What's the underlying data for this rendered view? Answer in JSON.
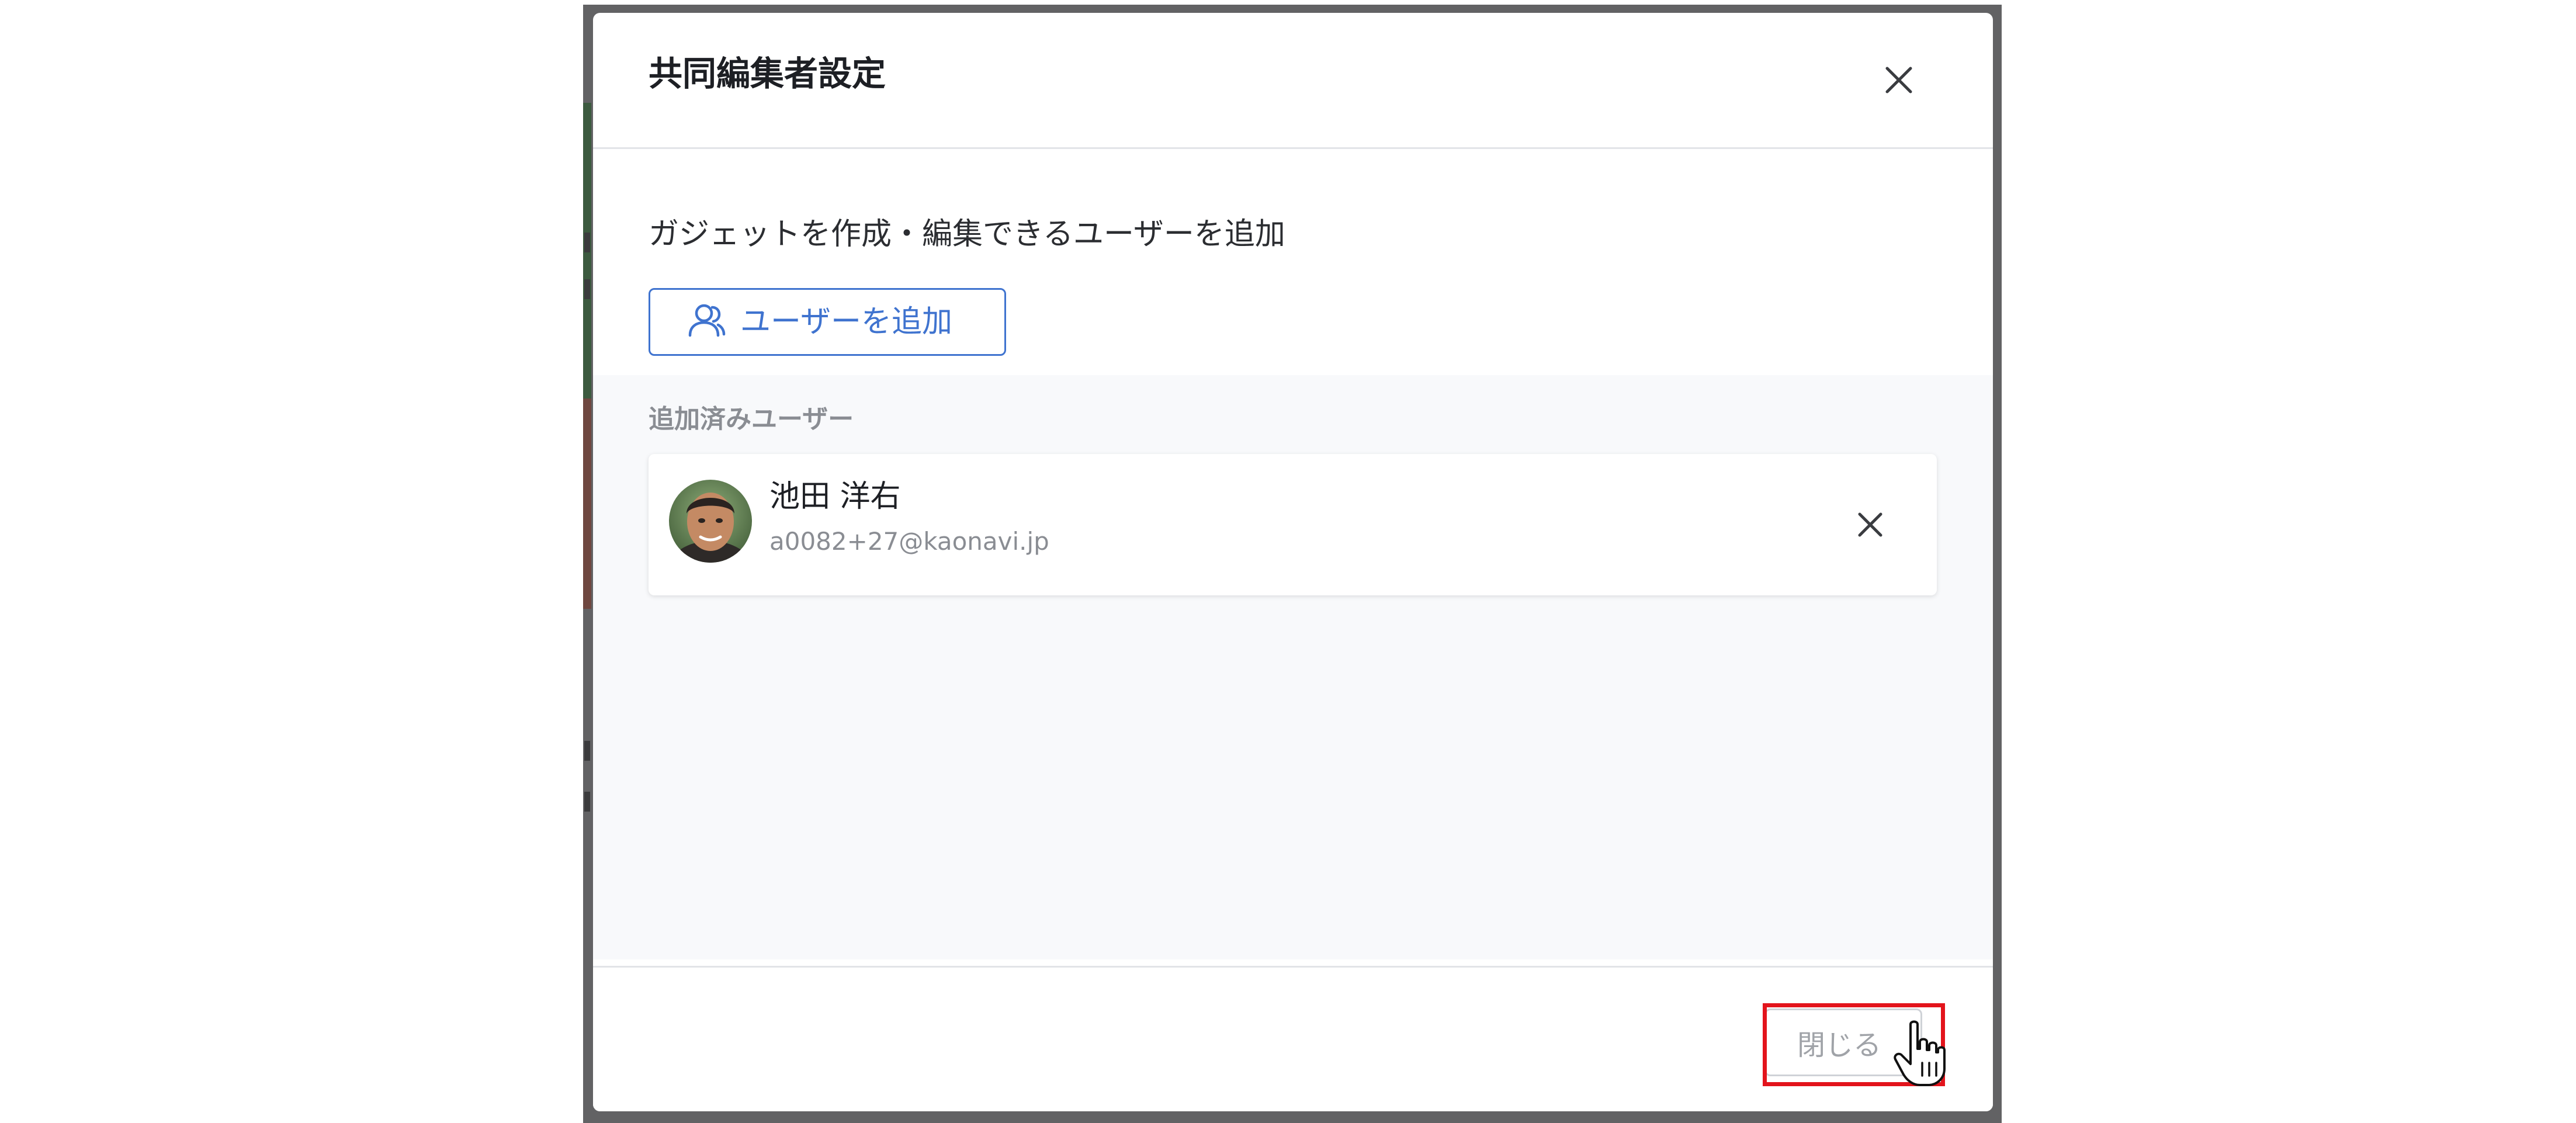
{
  "modal": {
    "title": "共同編集者設定",
    "description": "ガジェットを作成・編集できるユーザーを追加",
    "add_user_label": "ユーザーを追加",
    "added_users_label": "追加済みユーザー",
    "users": [
      {
        "name": "池田 洋右",
        "email": "a0082+27@kaonavi.jp"
      }
    ],
    "close_label": "閉じる"
  },
  "colors": {
    "accent": "#3f73cf",
    "highlight": "#e3141c",
    "overlay": "#626264"
  },
  "icons": {
    "close": "close-icon",
    "add_user": "users-icon",
    "remove": "close-icon",
    "cursor": "hand-pointer-icon"
  }
}
